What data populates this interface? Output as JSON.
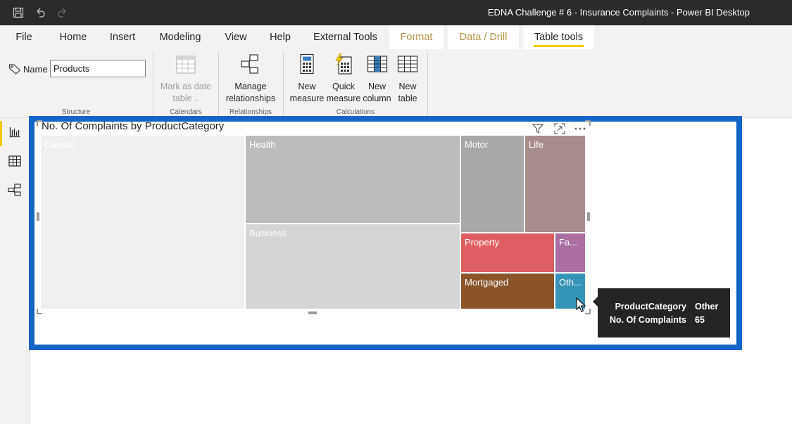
{
  "window": {
    "title": "EDNA Challenge # 6 - Insurance Complaints - Power BI Desktop"
  },
  "ribbon_tabs": [
    {
      "label": "File"
    },
    {
      "label": "Home"
    },
    {
      "label": "Insert"
    },
    {
      "label": "Modeling"
    },
    {
      "label": "View"
    },
    {
      "label": "Help"
    },
    {
      "label": "External Tools"
    },
    {
      "label": "Format"
    },
    {
      "label": "Data / Drill"
    },
    {
      "label": "Table tools"
    }
  ],
  "structure": {
    "name_label": "Name",
    "name_value": "Products",
    "group_label": "Structure"
  },
  "calendars": {
    "mark_date_line1": "Mark as date",
    "mark_date_line2": "table",
    "group_label": "Calendars"
  },
  "relationships": {
    "manage_line1": "Manage",
    "manage_line2": "relationships",
    "group_label": "Relationships"
  },
  "calculations": {
    "new_measure_line1": "New",
    "new_measure_line2": "measure",
    "quick_measure_line1": "Quick",
    "quick_measure_line2": "measure",
    "new_column_line1": "New",
    "new_column_line2": "column",
    "new_table_line1": "New",
    "new_table_line2": "table",
    "group_label": "Calculations"
  },
  "left_nav": [
    {
      "icon": "report-view-icon",
      "active": true
    },
    {
      "icon": "data-view-icon",
      "active": false
    },
    {
      "icon": "model-view-icon",
      "active": false
    }
  ],
  "visual": {
    "title": "No. Of Complaints by ProductCategory",
    "header_icons": [
      "filter-icon",
      "focus-mode-icon",
      "more-options-icon"
    ]
  },
  "chart_data": {
    "type": "treemap",
    "title": "No. Of Complaints by ProductCategory",
    "categories": [
      "Capital",
      "Health",
      "Business",
      "Motor",
      "Life",
      "Property",
      "Fa...",
      "Mortgaged",
      "Oth..."
    ],
    "colors": [
      "#efefef",
      "#bcbcbc",
      "#d5d5d5",
      "#a8a8a8",
      "#a88d8d",
      "#df5e62",
      "#a96fa0",
      "#8b5328",
      "#3794b9"
    ],
    "known_values": {
      "Other": 65
    }
  },
  "tooltip": {
    "rows": [
      {
        "key": "ProductCategory",
        "value": "Other"
      },
      {
        "key": "No. Of Complaints",
        "value": "65"
      }
    ]
  }
}
